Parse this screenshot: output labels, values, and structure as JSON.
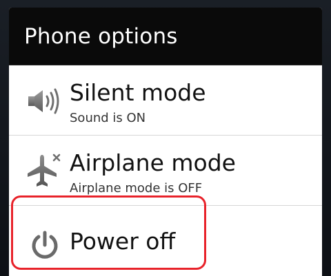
{
  "dialog": {
    "title": "Phone options"
  },
  "options": [
    {
      "label": "Silent mode",
      "status": "Sound is ON",
      "icon": "speaker-volume-icon"
    },
    {
      "label": "Airplane mode",
      "status": "Airplane mode is OFF",
      "icon": "airplane-icon"
    },
    {
      "label": "Power off",
      "icon": "power-icon"
    }
  ],
  "colors": {
    "title_bar": "#0a0a0a",
    "dialog_background": "#ffffff",
    "highlight": "#e8222a",
    "icon_gray": "#6f6f6f"
  }
}
